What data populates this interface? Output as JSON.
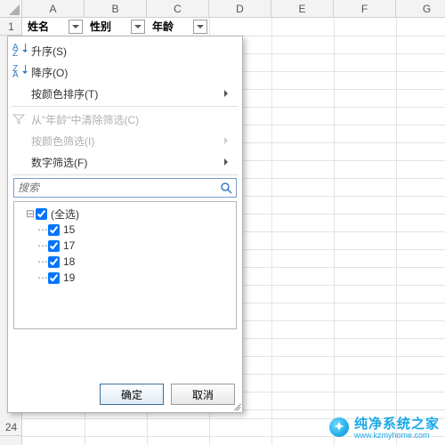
{
  "columns": [
    "A",
    "B",
    "C",
    "D",
    "E",
    "F",
    "G"
  ],
  "row_24_label": "24",
  "row1": "1",
  "headers": {
    "name": "姓名",
    "gender": "性别",
    "age": "年龄"
  },
  "menu": {
    "sort_asc": "升序(S)",
    "sort_desc": "降序(O)",
    "sort_color": "按颜色排序(T)",
    "clear_filter": "从\"年龄\"中清除筛选(C)",
    "filter_color": "按颜色筛选(I)",
    "number_filter": "数字筛选(F)"
  },
  "search": {
    "placeholder": "搜索"
  },
  "tree": {
    "all": "(全选)",
    "items": [
      "15",
      "17",
      "18",
      "19"
    ]
  },
  "buttons": {
    "ok": "确定",
    "cancel": "取消"
  },
  "watermark": {
    "text": "纯净系统之家",
    "url": "www.kzmyhome.com"
  }
}
